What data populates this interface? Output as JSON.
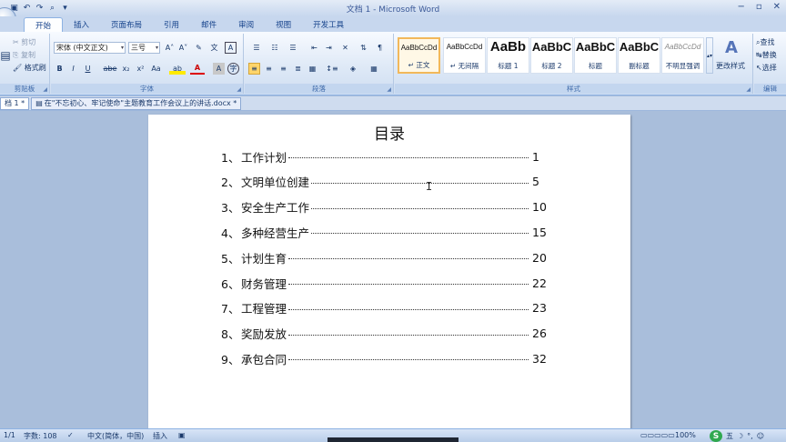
{
  "window": {
    "title": "文档 1 - Microsoft Word",
    "qat_items": [
      "save-icon",
      "undo-icon",
      "redo-icon",
      "print-preview-icon",
      "customize-icon"
    ]
  },
  "tabs": [
    "开始",
    "插入",
    "页面布局",
    "引用",
    "邮件",
    "审阅",
    "视图",
    "开发工具"
  ],
  "ribbon": {
    "clipboard": {
      "label": "剪贴板",
      "paste": "粘贴",
      "cut": "剪切",
      "copy": "复制",
      "format_painter": "格式刷"
    },
    "font": {
      "label": "字体",
      "font_name": "宋体 (中文正文)",
      "font_size": "三号",
      "bold": "B",
      "italic": "I",
      "underline": "U",
      "strike": "abe",
      "subscript": "x₂",
      "superscript": "x²",
      "change_case": "Aa",
      "highlight": "ab",
      "font_color": "A",
      "char_shading": "A",
      "enclose": "字"
    },
    "paragraph": {
      "label": "段落"
    },
    "styles": {
      "label": "样式",
      "items": [
        {
          "sample": "AaBbCcDd",
          "name": "↵ 正文"
        },
        {
          "sample": "AaBbCcDd",
          "name": "↵ 无间隔"
        },
        {
          "sample": "AaBb",
          "name": "标题 1"
        },
        {
          "sample": "AaBbC",
          "name": "标题 2"
        },
        {
          "sample": "AaBbC",
          "name": "标题"
        },
        {
          "sample": "AaBbC",
          "name": "副标题"
        },
        {
          "sample": "AaBbCcDd",
          "name": "不明显强调"
        }
      ],
      "change_styles": "更改样式"
    },
    "editing": {
      "label": "编辑",
      "find": "查找",
      "replace": "替换",
      "select": "选择"
    }
  },
  "doc_tabs": [
    {
      "label": "档 1 *",
      "active": true
    },
    {
      "label": "在\"不忘初心、牢记使命\"主题教育工作会议上的讲话.docx *",
      "active": false
    }
  ],
  "document": {
    "title": "目录",
    "toc": [
      {
        "num": "1、",
        "text": "工作计划",
        "page": "1"
      },
      {
        "num": "2、",
        "text": "文明单位创建",
        "page": "5"
      },
      {
        "num": "3、",
        "text": "安全生产工作",
        "page": "10"
      },
      {
        "num": "4、",
        "text": "多种经营生产",
        "page": "15"
      },
      {
        "num": "5、",
        "text": "计划生育",
        "page": "20"
      },
      {
        "num": "6、",
        "text": "财务管理",
        "page": "22"
      },
      {
        "num": "7、",
        "text": "工程管理",
        "page": "23"
      },
      {
        "num": "8、",
        "text": "奖励发放",
        "page": "26"
      },
      {
        "num": "9、",
        "text": "承包合同",
        "page": "32"
      }
    ]
  },
  "status": {
    "page": "1/1",
    "word_count": "字数: 108",
    "language": "中文(简体，中国)",
    "mode": "插入",
    "zoom": "100%",
    "ime": "五"
  }
}
